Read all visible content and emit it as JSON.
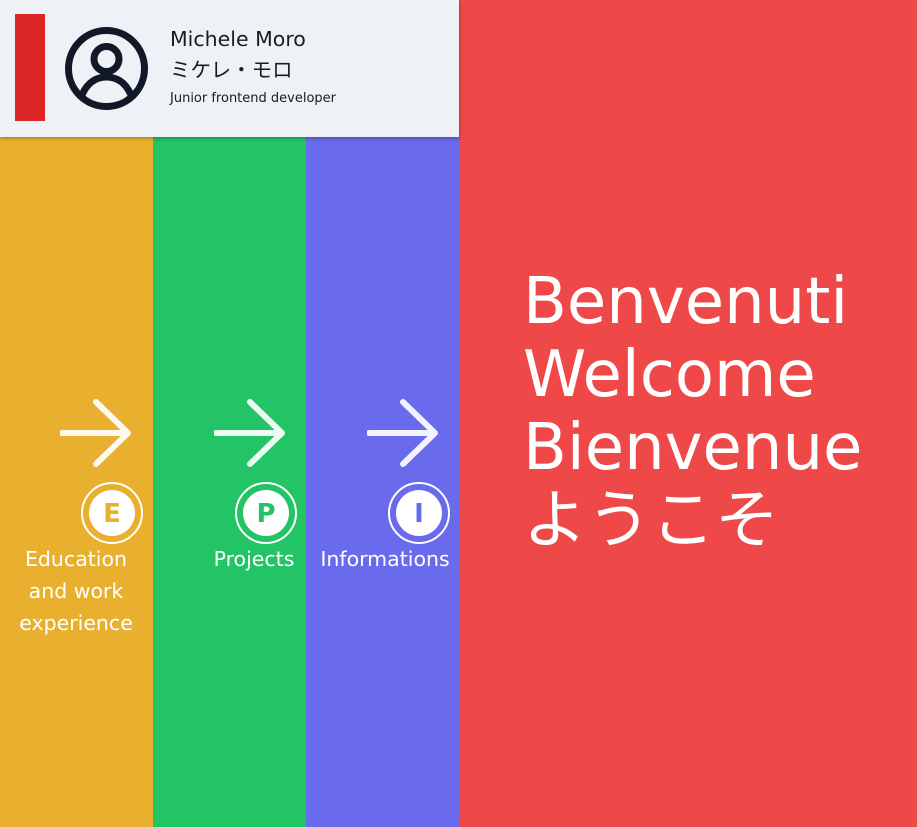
{
  "colors": {
    "header_bg": "#eef2f7",
    "accent_red": "#dc2626",
    "education_yellow": "#e9b030",
    "projects_green": "#22c466",
    "info_indigo": "#6a6bec",
    "main_red": "#ef4848",
    "avatar_dark": "#111827"
  },
  "header": {
    "avatar_icon": "user-circle-icon",
    "name": "Michele Moro",
    "name_jp": "ミケレ・モロ",
    "role": "Junior frontend developer"
  },
  "nav": [
    {
      "key": "education",
      "badge_letter": "E",
      "label": "Education\nand work\nexperience",
      "icon": "arrow-right-icon"
    },
    {
      "key": "projects",
      "badge_letter": "P",
      "label": "Projects",
      "icon": "arrow-right-icon"
    },
    {
      "key": "informations",
      "badge_letter": "I",
      "label": "Informations",
      "icon": "arrow-right-icon"
    }
  ],
  "main": {
    "welcome_lines": [
      "Benvenuti",
      "Welcome",
      "Bienvenue",
      "ようこそ"
    ]
  }
}
